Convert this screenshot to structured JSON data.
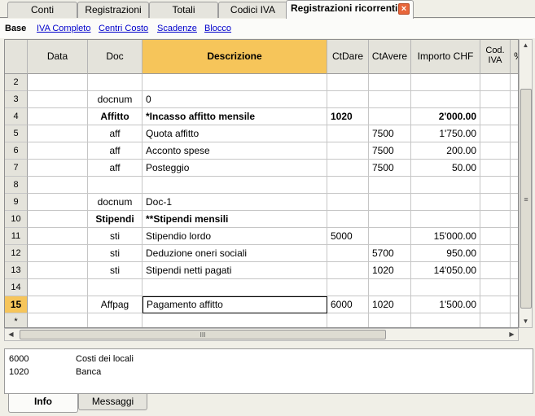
{
  "tabs": [
    {
      "label": "Conti"
    },
    {
      "label": "Registrazioni"
    },
    {
      "label": "Totali"
    },
    {
      "label": "Codici IVA"
    },
    {
      "label": "Registrazioni ricorrenti",
      "active": true
    }
  ],
  "views": [
    {
      "label": "Base",
      "active": true
    },
    {
      "label": "IVA Completo"
    },
    {
      "label": "Centri Costo"
    },
    {
      "label": "Scadenze"
    },
    {
      "label": "Blocco"
    }
  ],
  "columns": {
    "data": "Data",
    "doc": "Doc",
    "descrizione": "Descrizione",
    "ctdare": "CtDare",
    "ctavere": "CtAvere",
    "importo": "Importo CHF",
    "codiva_1": "Cod.",
    "codiva_2": "IVA",
    "pct": "%"
  },
  "rows": [
    {
      "num": "2",
      "doc": "",
      "desc": "",
      "ctdare": "",
      "ctavere": "",
      "importo": ""
    },
    {
      "num": "3",
      "doc": "docnum",
      "desc": "0",
      "ctdare": "",
      "ctavere": "",
      "importo": ""
    },
    {
      "num": "4",
      "doc": "Affitto",
      "desc": "*Incasso affitto mensile",
      "ctdare": "1020",
      "ctavere": "",
      "importo": "2'000.00",
      "bold": true
    },
    {
      "num": "5",
      "doc": "aff",
      "desc": "Quota affitto",
      "ctdare": "",
      "ctavere": "7500",
      "importo": "1'750.00"
    },
    {
      "num": "6",
      "doc": "aff",
      "desc": "Acconto spese",
      "ctdare": "",
      "ctavere": "7500",
      "importo": "200.00"
    },
    {
      "num": "7",
      "doc": "aff",
      "desc": "Posteggio",
      "ctdare": "",
      "ctavere": "7500",
      "importo": "50.00"
    },
    {
      "num": "8",
      "doc": "",
      "desc": "",
      "ctdare": "",
      "ctavere": "",
      "importo": ""
    },
    {
      "num": "9",
      "doc": "docnum",
      "desc": "Doc-1",
      "ctdare": "",
      "ctavere": "",
      "importo": ""
    },
    {
      "num": "10",
      "doc": "Stipendi",
      "desc": "**Stipendi mensili",
      "ctdare": "",
      "ctavere": "",
      "importo": "",
      "bold": true
    },
    {
      "num": "11",
      "doc": "sti",
      "desc": "Stipendio lordo",
      "ctdare": "5000",
      "ctavere": "",
      "importo": "15'000.00"
    },
    {
      "num": "12",
      "doc": "sti",
      "desc": "Deduzione oneri sociali",
      "ctdare": "",
      "ctavere": "5700",
      "importo": "950.00"
    },
    {
      "num": "13",
      "doc": "sti",
      "desc": "Stipendi netti pagati",
      "ctdare": "",
      "ctavere": "1020",
      "importo": "14'050.00"
    },
    {
      "num": "14",
      "doc": "",
      "desc": "",
      "ctdare": "",
      "ctavere": "",
      "importo": ""
    },
    {
      "num": "15",
      "doc": "Affpag",
      "desc": "Pagamento affitto",
      "ctdare": "6000",
      "ctavere": "1020",
      "importo": "1'500.00",
      "current": true
    },
    {
      "num": "*",
      "doc": "",
      "desc": "",
      "ctdare": "",
      "ctavere": "",
      "importo": ""
    }
  ],
  "scroll_grip": "≡",
  "hscroll_grip": "III",
  "info": [
    {
      "code": "6000",
      "desc": "Costi dei locali"
    },
    {
      "code": "1020",
      "desc": "Banca"
    }
  ],
  "bottom_tabs": [
    {
      "label": "Info",
      "active": true
    },
    {
      "label": "Messaggi"
    }
  ],
  "colors": {
    "header_highlight": "#f6c55a",
    "link": "#0000cc",
    "close": "#e8663b"
  }
}
